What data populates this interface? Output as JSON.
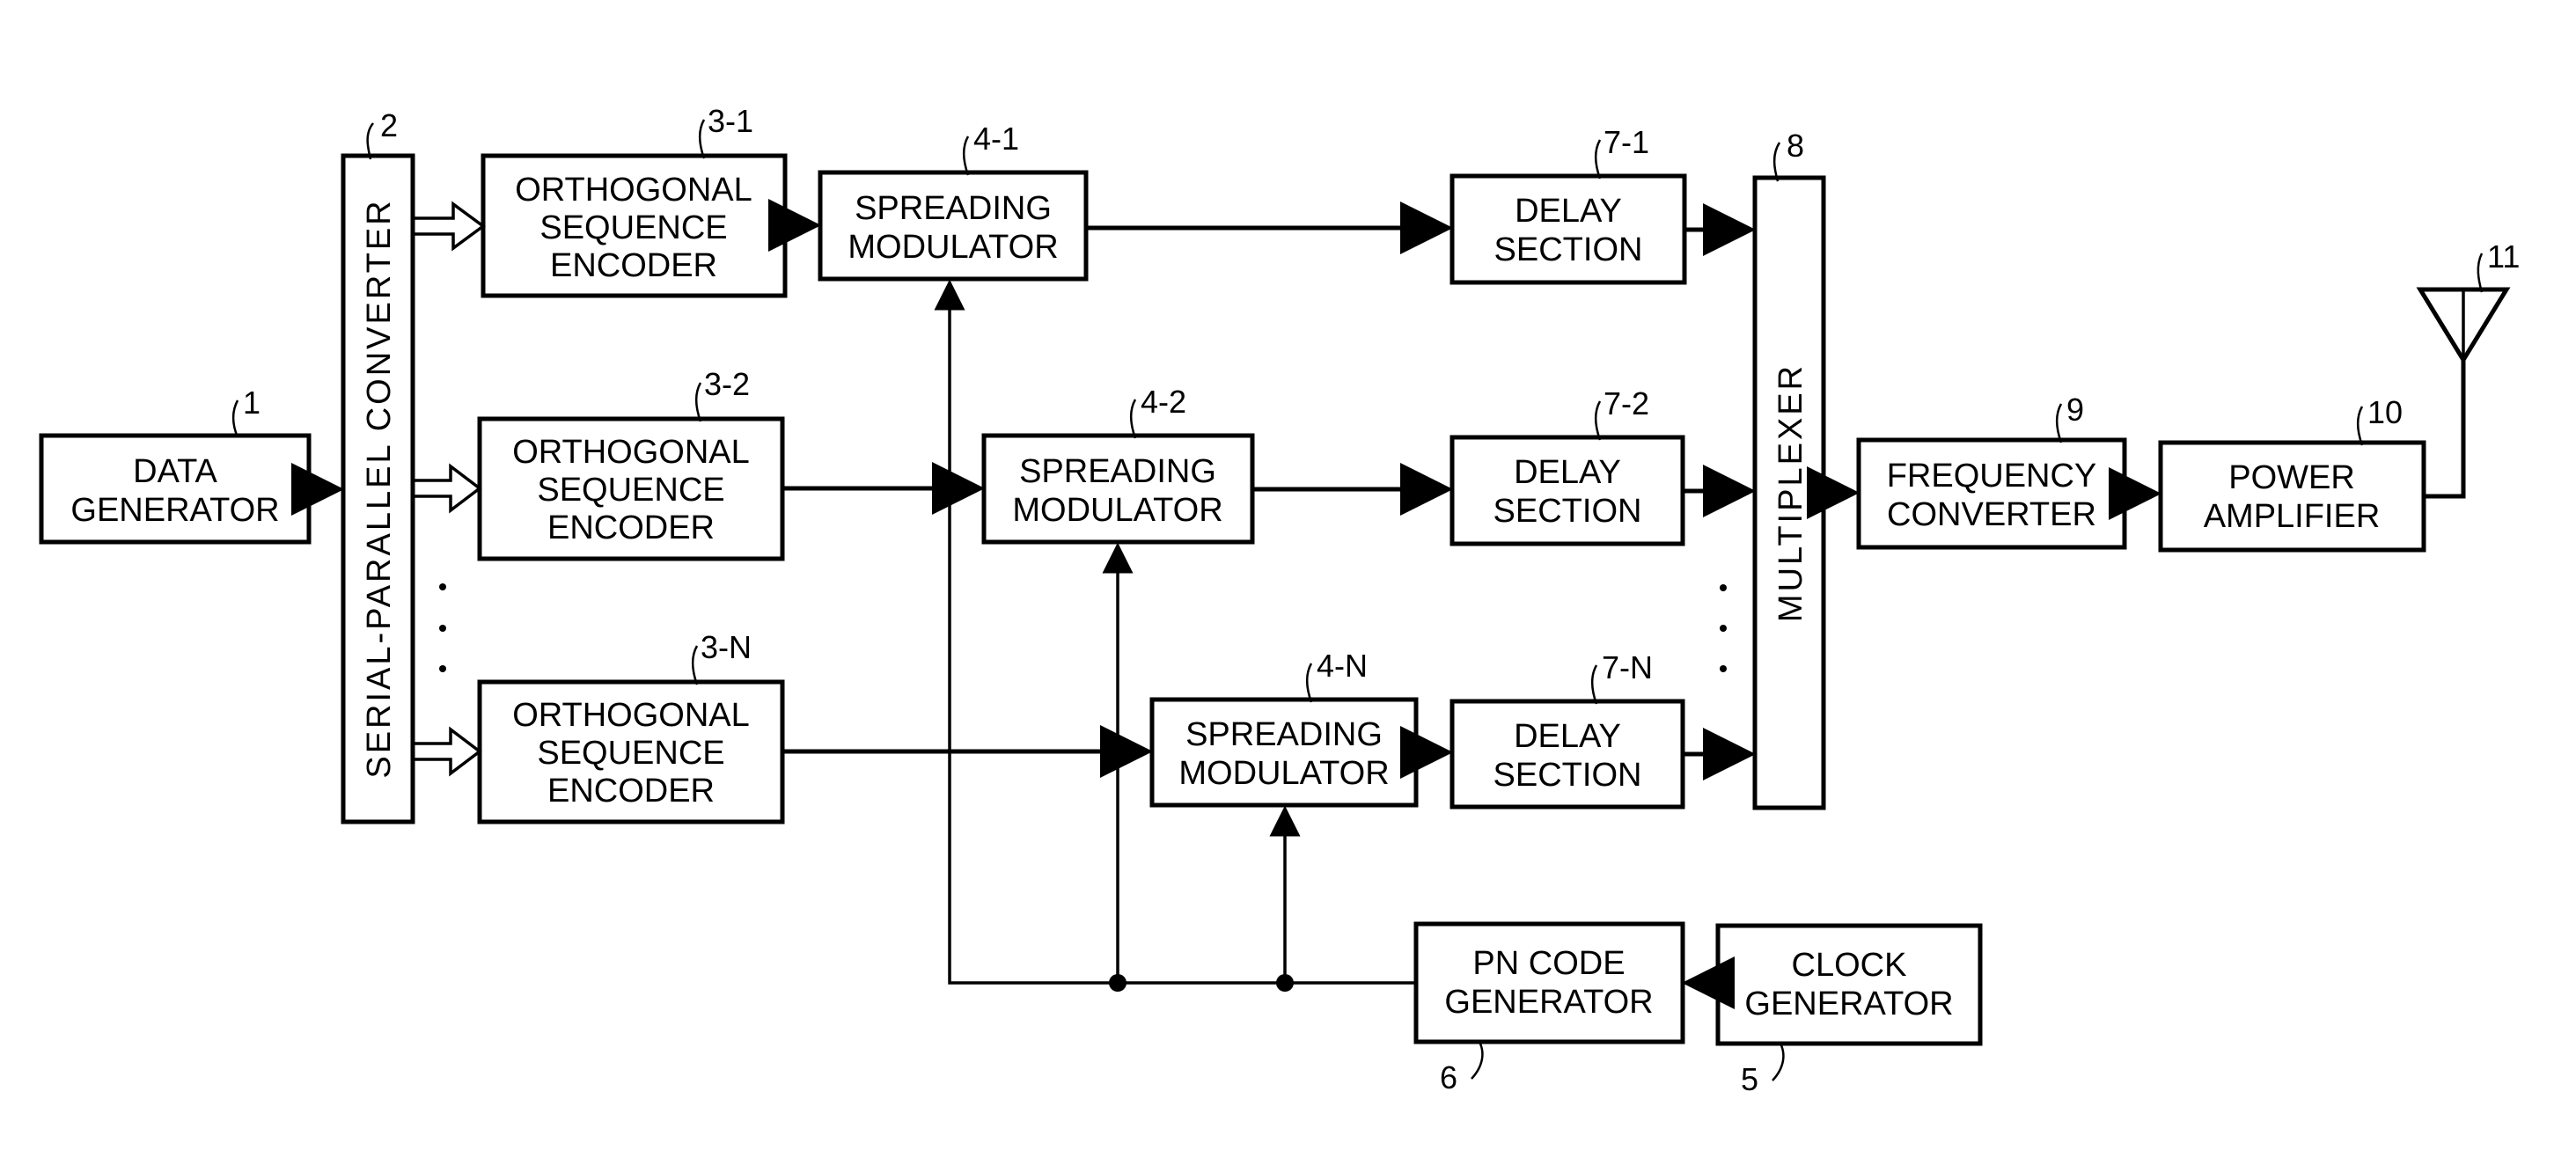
{
  "diagram": {
    "type": "block-diagram",
    "blocks": [
      {
        "id": "data_generator",
        "ref": "1",
        "lines": [
          "DATA",
          "GENERATOR"
        ]
      },
      {
        "id": "serial_parallel_converter",
        "ref": "2",
        "lines": [
          "SERIAL-PARALLEL CONVERTER"
        ]
      },
      {
        "id": "ortho_1",
        "ref": "3-1",
        "lines": [
          "ORTHOGONAL",
          "SEQUENCE",
          "ENCODER"
        ]
      },
      {
        "id": "ortho_2",
        "ref": "3-2",
        "lines": [
          "ORTHOGONAL",
          "SEQUENCE",
          "ENCODER"
        ]
      },
      {
        "id": "ortho_n",
        "ref": "3-N",
        "lines": [
          "ORTHOGONAL",
          "SEQUENCE",
          "ENCODER"
        ]
      },
      {
        "id": "spread_1",
        "ref": "4-1",
        "lines": [
          "SPREADING",
          "MODULATOR"
        ]
      },
      {
        "id": "spread_2",
        "ref": "4-2",
        "lines": [
          "SPREADING",
          "MODULATOR"
        ]
      },
      {
        "id": "spread_n",
        "ref": "4-N",
        "lines": [
          "SPREADING",
          "MODULATOR"
        ]
      },
      {
        "id": "delay_1",
        "ref": "7-1",
        "lines": [
          "DELAY",
          "SECTION"
        ]
      },
      {
        "id": "delay_2",
        "ref": "7-2",
        "lines": [
          "DELAY",
          "SECTION"
        ]
      },
      {
        "id": "delay_n",
        "ref": "7-N",
        "lines": [
          "DELAY",
          "SECTION"
        ]
      },
      {
        "id": "multiplexer",
        "ref": "8",
        "lines": [
          "MULTIPLEXER"
        ]
      },
      {
        "id": "frequency_converter",
        "ref": "9",
        "lines": [
          "FREQUENCY",
          "CONVERTER"
        ]
      },
      {
        "id": "power_amplifier",
        "ref": "10",
        "lines": [
          "POWER",
          "AMPLIFIER"
        ]
      },
      {
        "id": "antenna",
        "ref": "11",
        "lines": []
      },
      {
        "id": "pn_code_generator",
        "ref": "6",
        "lines": [
          "PN CODE",
          "GENERATOR"
        ]
      },
      {
        "id": "clock_generator",
        "ref": "5",
        "lines": [
          "CLOCK",
          "GENERATOR"
        ]
      }
    ],
    "connections": [
      {
        "from": "data_generator",
        "to": "serial_parallel_converter"
      },
      {
        "from": "serial_parallel_converter",
        "to": "ortho_1",
        "style": "hollow-arrow"
      },
      {
        "from": "serial_parallel_converter",
        "to": "ortho_2",
        "style": "hollow-arrow"
      },
      {
        "from": "serial_parallel_converter",
        "to": "ortho_n",
        "style": "hollow-arrow"
      },
      {
        "from": "ortho_1",
        "to": "spread_1"
      },
      {
        "from": "ortho_2",
        "to": "spread_2"
      },
      {
        "from": "ortho_n",
        "to": "spread_n"
      },
      {
        "from": "spread_1",
        "to": "delay_1"
      },
      {
        "from": "spread_2",
        "to": "delay_2"
      },
      {
        "from": "spread_n",
        "to": "delay_n"
      },
      {
        "from": "delay_1",
        "to": "multiplexer"
      },
      {
        "from": "delay_2",
        "to": "multiplexer"
      },
      {
        "from": "delay_n",
        "to": "multiplexer"
      },
      {
        "from": "multiplexer",
        "to": "frequency_converter"
      },
      {
        "from": "frequency_converter",
        "to": "power_amplifier"
      },
      {
        "from": "power_amplifier",
        "to": "antenna"
      },
      {
        "from": "clock_generator",
        "to": "pn_code_generator"
      },
      {
        "from": "pn_code_generator",
        "to": "spread_1"
      },
      {
        "from": "pn_code_generator",
        "to": "spread_2"
      },
      {
        "from": "pn_code_generator",
        "to": "spread_n"
      }
    ],
    "ellipsis": "⋮"
  }
}
